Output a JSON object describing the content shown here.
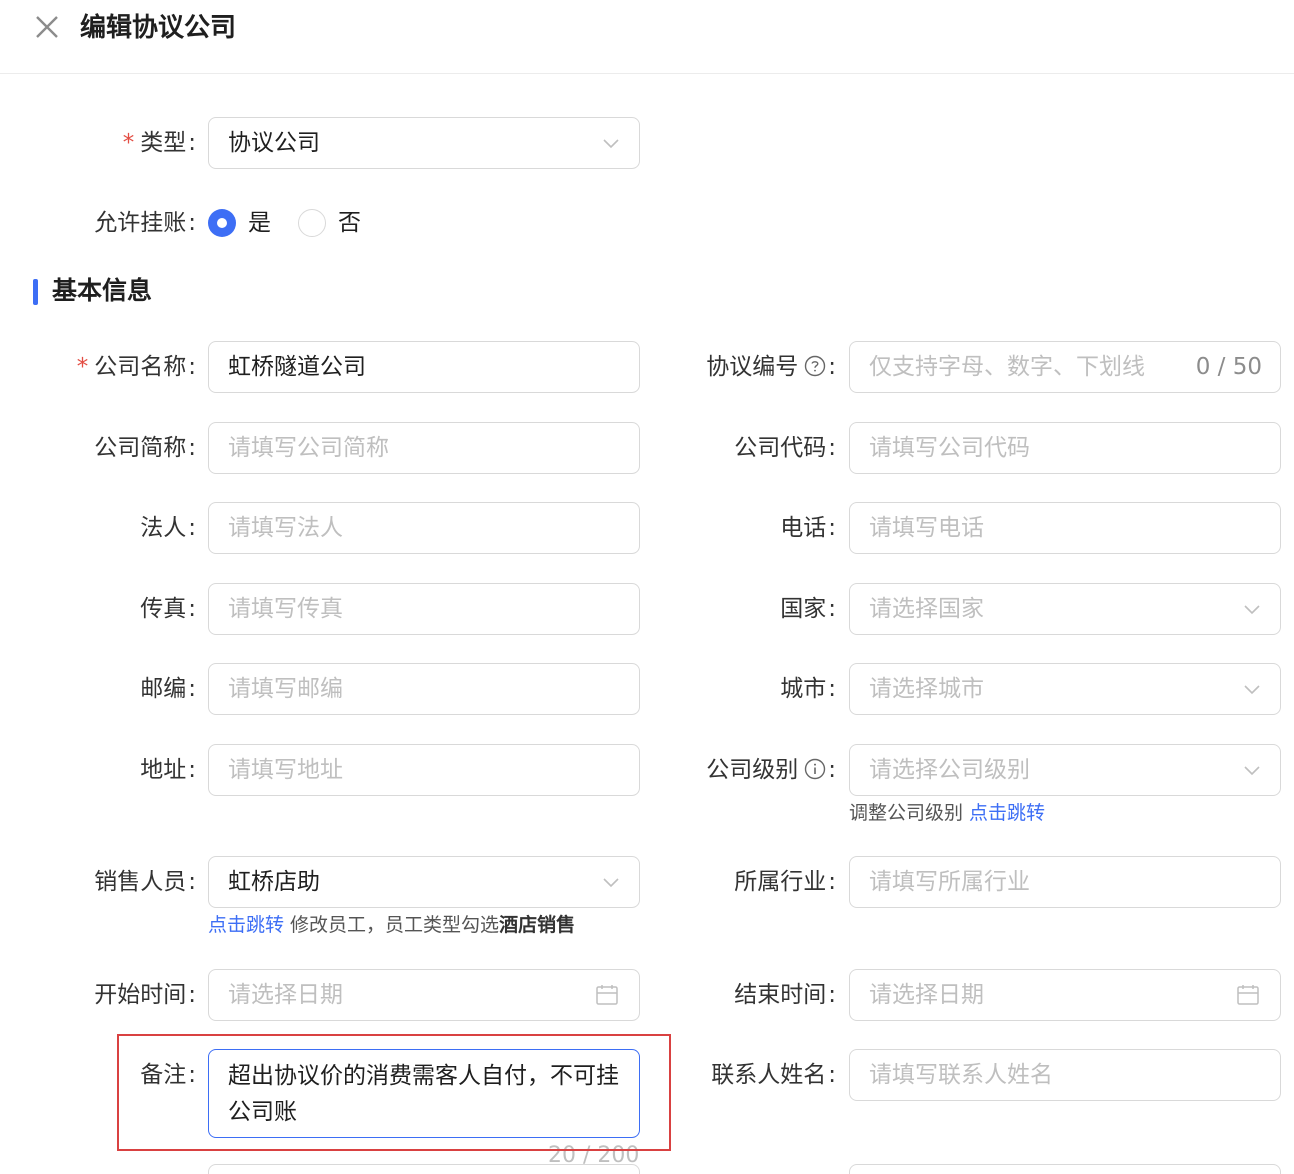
{
  "header": {
    "title": "编辑协议公司",
    "close_icon": "close-icon"
  },
  "type_field": {
    "label": "类型",
    "value": "协议公司"
  },
  "credit": {
    "label": "允许挂账",
    "options": [
      "是",
      "否"
    ],
    "selected": "是"
  },
  "section": {
    "title": "基本信息"
  },
  "left": {
    "company_name": {
      "label": "公司名称",
      "value": "虹桥隧道公司"
    },
    "short_name": {
      "label": "公司简称",
      "placeholder": "请填写公司简称"
    },
    "legal_person": {
      "label": "法人",
      "placeholder": "请填写法人"
    },
    "fax": {
      "label": "传真",
      "placeholder": "请填写传真"
    },
    "zip": {
      "label": "邮编",
      "placeholder": "请填写邮编"
    },
    "address": {
      "label": "地址",
      "placeholder": "请填写地址"
    },
    "sales": {
      "label": "销售人员",
      "value": "虹桥店助",
      "hint_link": "点击跳转",
      "hint_text": " 修改员工，员工类型勾选",
      "hint_strong": "酒店销售"
    },
    "start_time": {
      "label": "开始时间",
      "placeholder": "请选择日期"
    },
    "remark": {
      "label": "备注",
      "value": "超出协议价的消费需客人自付，不可挂公司账",
      "count": "20 / 200"
    }
  },
  "right": {
    "agreement_no": {
      "label": "协议编号",
      "placeholder": "仅支持字母、数字、下划线",
      "count": "0 / 50"
    },
    "company_code": {
      "label": "公司代码",
      "placeholder": "请填写公司代码"
    },
    "phone": {
      "label": "电话",
      "placeholder": "请填写电话"
    },
    "country": {
      "label": "国家",
      "placeholder": "请选择国家"
    },
    "city": {
      "label": "城市",
      "placeholder": "请选择城市"
    },
    "level": {
      "label": "公司级别",
      "placeholder": "请选择公司级别",
      "hint_text": "调整公司级别 ",
      "hint_link": "点击跳转"
    },
    "industry": {
      "label": "所属行业",
      "placeholder": "请填写所属行业"
    },
    "end_time": {
      "label": "结束时间",
      "placeholder": "请选择日期"
    },
    "contact_name": {
      "label": "联系人姓名",
      "placeholder": "请填写联系人姓名"
    }
  },
  "colors": {
    "primary": "#3d6ef5",
    "required": "#e34d43",
    "highlight": "#d94141"
  }
}
